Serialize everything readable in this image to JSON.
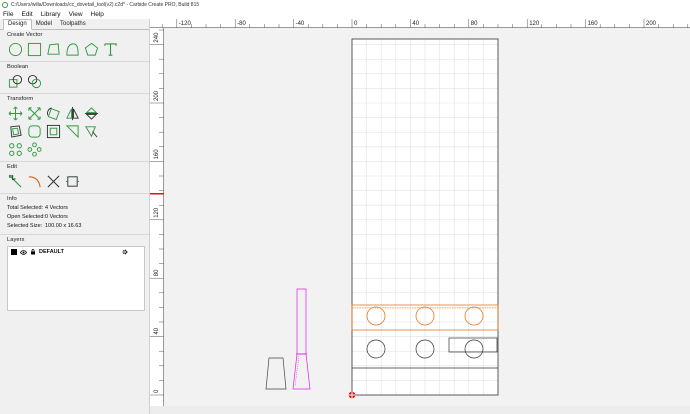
{
  "app": {
    "title": "C:/Users/willa/Downloads/cc_dovetail_tool(v2).c2d* - Carbide Create PRO, Build 815"
  },
  "menu": [
    "File",
    "Edit",
    "Library",
    "View",
    "Help"
  ],
  "tabs": [
    "Design",
    "Model",
    "Toolpaths"
  ],
  "sections": {
    "create_vector": "Create Vector",
    "boolean": "Boolean",
    "transform": "Transform",
    "edit": "Edit",
    "info": "Info",
    "layers": "Layers"
  },
  "icons": {
    "create_vector": [
      "circle-icon",
      "rectangle-icon",
      "polygon-icon",
      "curve-icon",
      "pentagon-icon",
      "text-icon"
    ],
    "boolean": [
      "union-icon",
      "subtract-icon"
    ],
    "transform_row1": [
      "move-icon",
      "scale-icon",
      "rotate-icon",
      "mirror-icon",
      "flip-icon"
    ],
    "transform_row2": [
      "offset-icon",
      "fillet-icon",
      "inset-icon",
      "shape-icon",
      "align-icon"
    ],
    "transform_row3": [
      "grid-array-icon",
      "circular-array-icon"
    ],
    "edit": [
      "node-edit-icon",
      "arc-icon",
      "trim-icon",
      "join-icon"
    ]
  },
  "info": {
    "total_selected_label": "Total Selected:",
    "total_selected_value": "4 Vectors",
    "open_selected_label": "Open Selected:",
    "open_selected_value": "0 Vectors",
    "selected_size_label": "Selected Size:",
    "selected_size_value": "100.00 x 16.63"
  },
  "layers": [
    {
      "name": "DEFAULT",
      "color": "#000000"
    }
  ],
  "rulers": {
    "x_ticks": [
      "-120",
      "-80",
      "-40",
      "0",
      "40",
      "80",
      "120",
      "160",
      "200"
    ],
    "y_ticks": [
      "240",
      "200",
      "160",
      "120",
      "80",
      "40",
      "0"
    ]
  },
  "colors": {
    "accent_green": "#2e9a3c",
    "selected_orange": "#e8781e",
    "toolpath_magenta": "#e020e0",
    "origin_red": "#dd1111"
  }
}
